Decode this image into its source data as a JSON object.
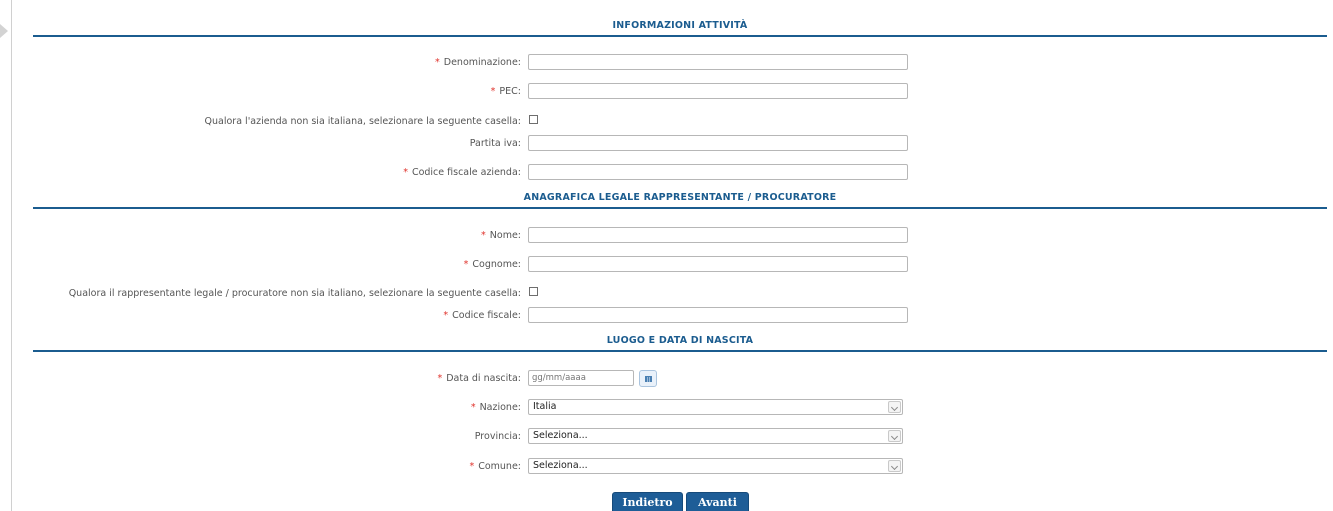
{
  "sections": {
    "info": "INFORMAZIONI ATTIVITÀ",
    "legale": "ANAGRAFICA LEGALE RAPPRESENTANTE / PROCURATORE",
    "nascita": "LUOGO E DATA DI NASCITA"
  },
  "required_mark": "*",
  "fields": {
    "denominazione": {
      "label": "Denominazione:",
      "value": ""
    },
    "pec": {
      "label": "PEC:",
      "value": ""
    },
    "azienda_estera": {
      "label": "Qualora l'azienda non sia italiana, selezionare la seguente casella:",
      "checked": false
    },
    "partita_iva": {
      "label": "Partita iva:",
      "value": ""
    },
    "codice_fiscale_azienda": {
      "label": "Codice fiscale azienda:",
      "value": ""
    },
    "nome": {
      "label": "Nome:",
      "value": ""
    },
    "cognome": {
      "label": "Cognome:",
      "value": ""
    },
    "rappresentante_estero": {
      "label": "Qualora il rappresentante legale / procuratore non sia italiano, selezionare la seguente casella:",
      "checked": false
    },
    "codice_fiscale": {
      "label": "Codice fiscale:",
      "value": ""
    },
    "data_nascita": {
      "label": "Data di nascita:",
      "placeholder": "gg/mm/aaaa"
    },
    "nazione": {
      "label": "Nazione:",
      "value": "Italia"
    },
    "provincia": {
      "label": "Provincia:",
      "value": "Seleziona..."
    },
    "comune": {
      "label": "Comune:",
      "value": "Seleziona..."
    }
  },
  "buttons": {
    "back": "Indietro",
    "next": "Avanti"
  },
  "icons": {
    "calendar": "calendar-icon",
    "dropdown": "chevron-down-icon",
    "sidebar_toggle": "arrow-right-icon"
  },
  "colors": {
    "accent": "#1b5c8f",
    "required": "#e0322b",
    "button": "#1e5d97"
  }
}
